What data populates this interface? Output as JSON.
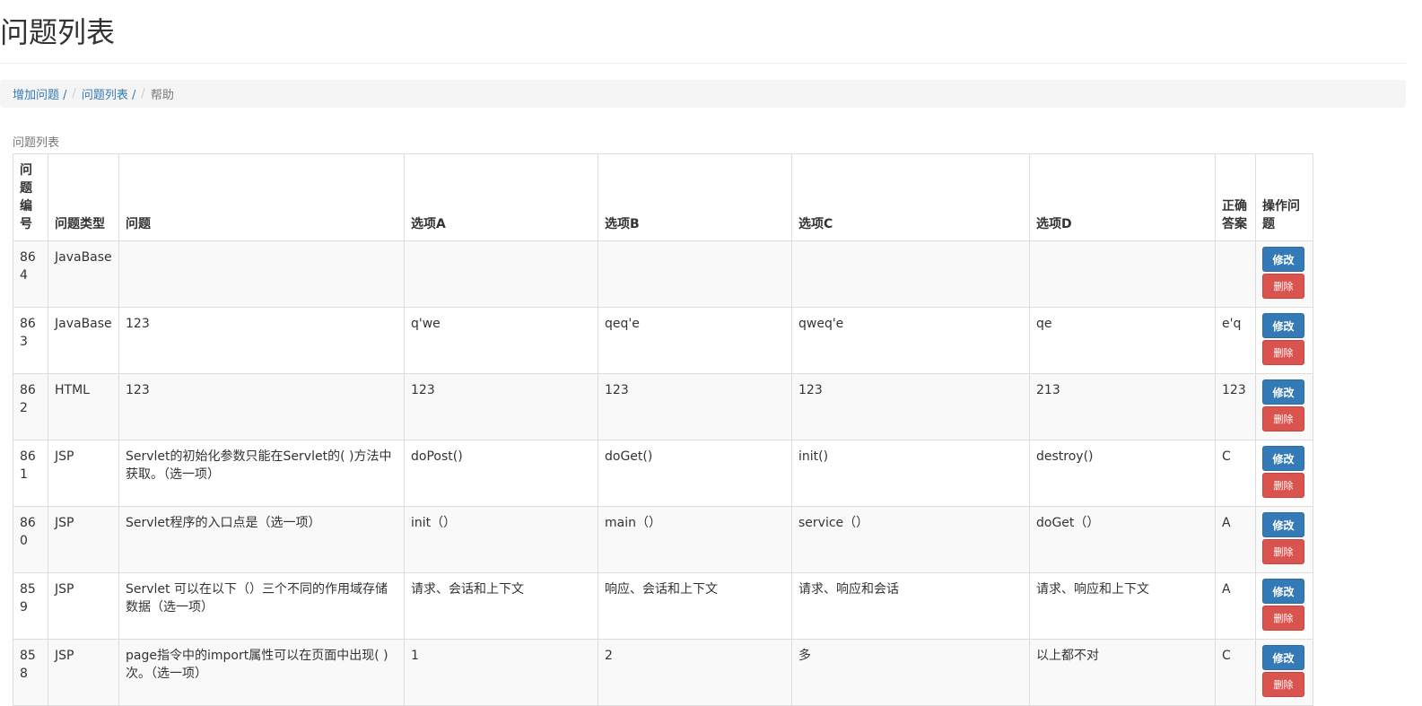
{
  "page": {
    "title": "问题列表"
  },
  "breadcrumb": [
    {
      "label": "增加问题 /",
      "link": true
    },
    {
      "label": "问题列表 /",
      "link": true
    },
    {
      "label": "帮助",
      "link": false
    }
  ],
  "table": {
    "caption": "问题列表",
    "headers": [
      "问题编号",
      "问题类型",
      "问题",
      "选项A",
      "选项B",
      "选项C",
      "选项D",
      "正确答案",
      "操作问题"
    ],
    "edit_label": "修改",
    "delete_label": "删除",
    "rows": [
      {
        "id": "864",
        "type": "JavaBase",
        "question": "",
        "a": "",
        "b": "",
        "c": "",
        "d": "",
        "answer": ""
      },
      {
        "id": "863",
        "type": "JavaBase",
        "question": "123",
        "a": "q'we",
        "b": "qeq'e",
        "c": "qweq'e",
        "d": "qe",
        "answer": "e'q"
      },
      {
        "id": "862",
        "type": "HTML",
        "question": "123",
        "a": "123",
        "b": "123",
        "c": "123",
        "d": "213",
        "answer": "123"
      },
      {
        "id": "861",
        "type": "JSP",
        "question": "Servlet的初始化参数只能在Servlet的( )方法中获取。（选一项）",
        "a": "doPost()",
        "b": "doGet()",
        "c": "init()",
        "d": "destroy()",
        "answer": "C"
      },
      {
        "id": "860",
        "type": "JSP",
        "question": "Servlet程序的入口点是（选一项）",
        "a": "init（）",
        "b": "main（）",
        "c": "service（）",
        "d": "doGet（）",
        "answer": "A"
      },
      {
        "id": "859",
        "type": "JSP",
        "question": "Servlet 可以在以下（）三个不同的作用域存储数据（选一项）",
        "a": "请求、会话和上下文",
        "b": "响应、会话和上下文",
        "c": "请求、响应和会话",
        "d": "请求、响应和上下文",
        "answer": "A"
      },
      {
        "id": "858",
        "type": "JSP",
        "question": "page指令中的import属性可以在页面中出现( )次。（选一项）",
        "a": "1",
        "b": "2",
        "c": "多",
        "d": "以上都不对",
        "answer": "C"
      }
    ]
  }
}
